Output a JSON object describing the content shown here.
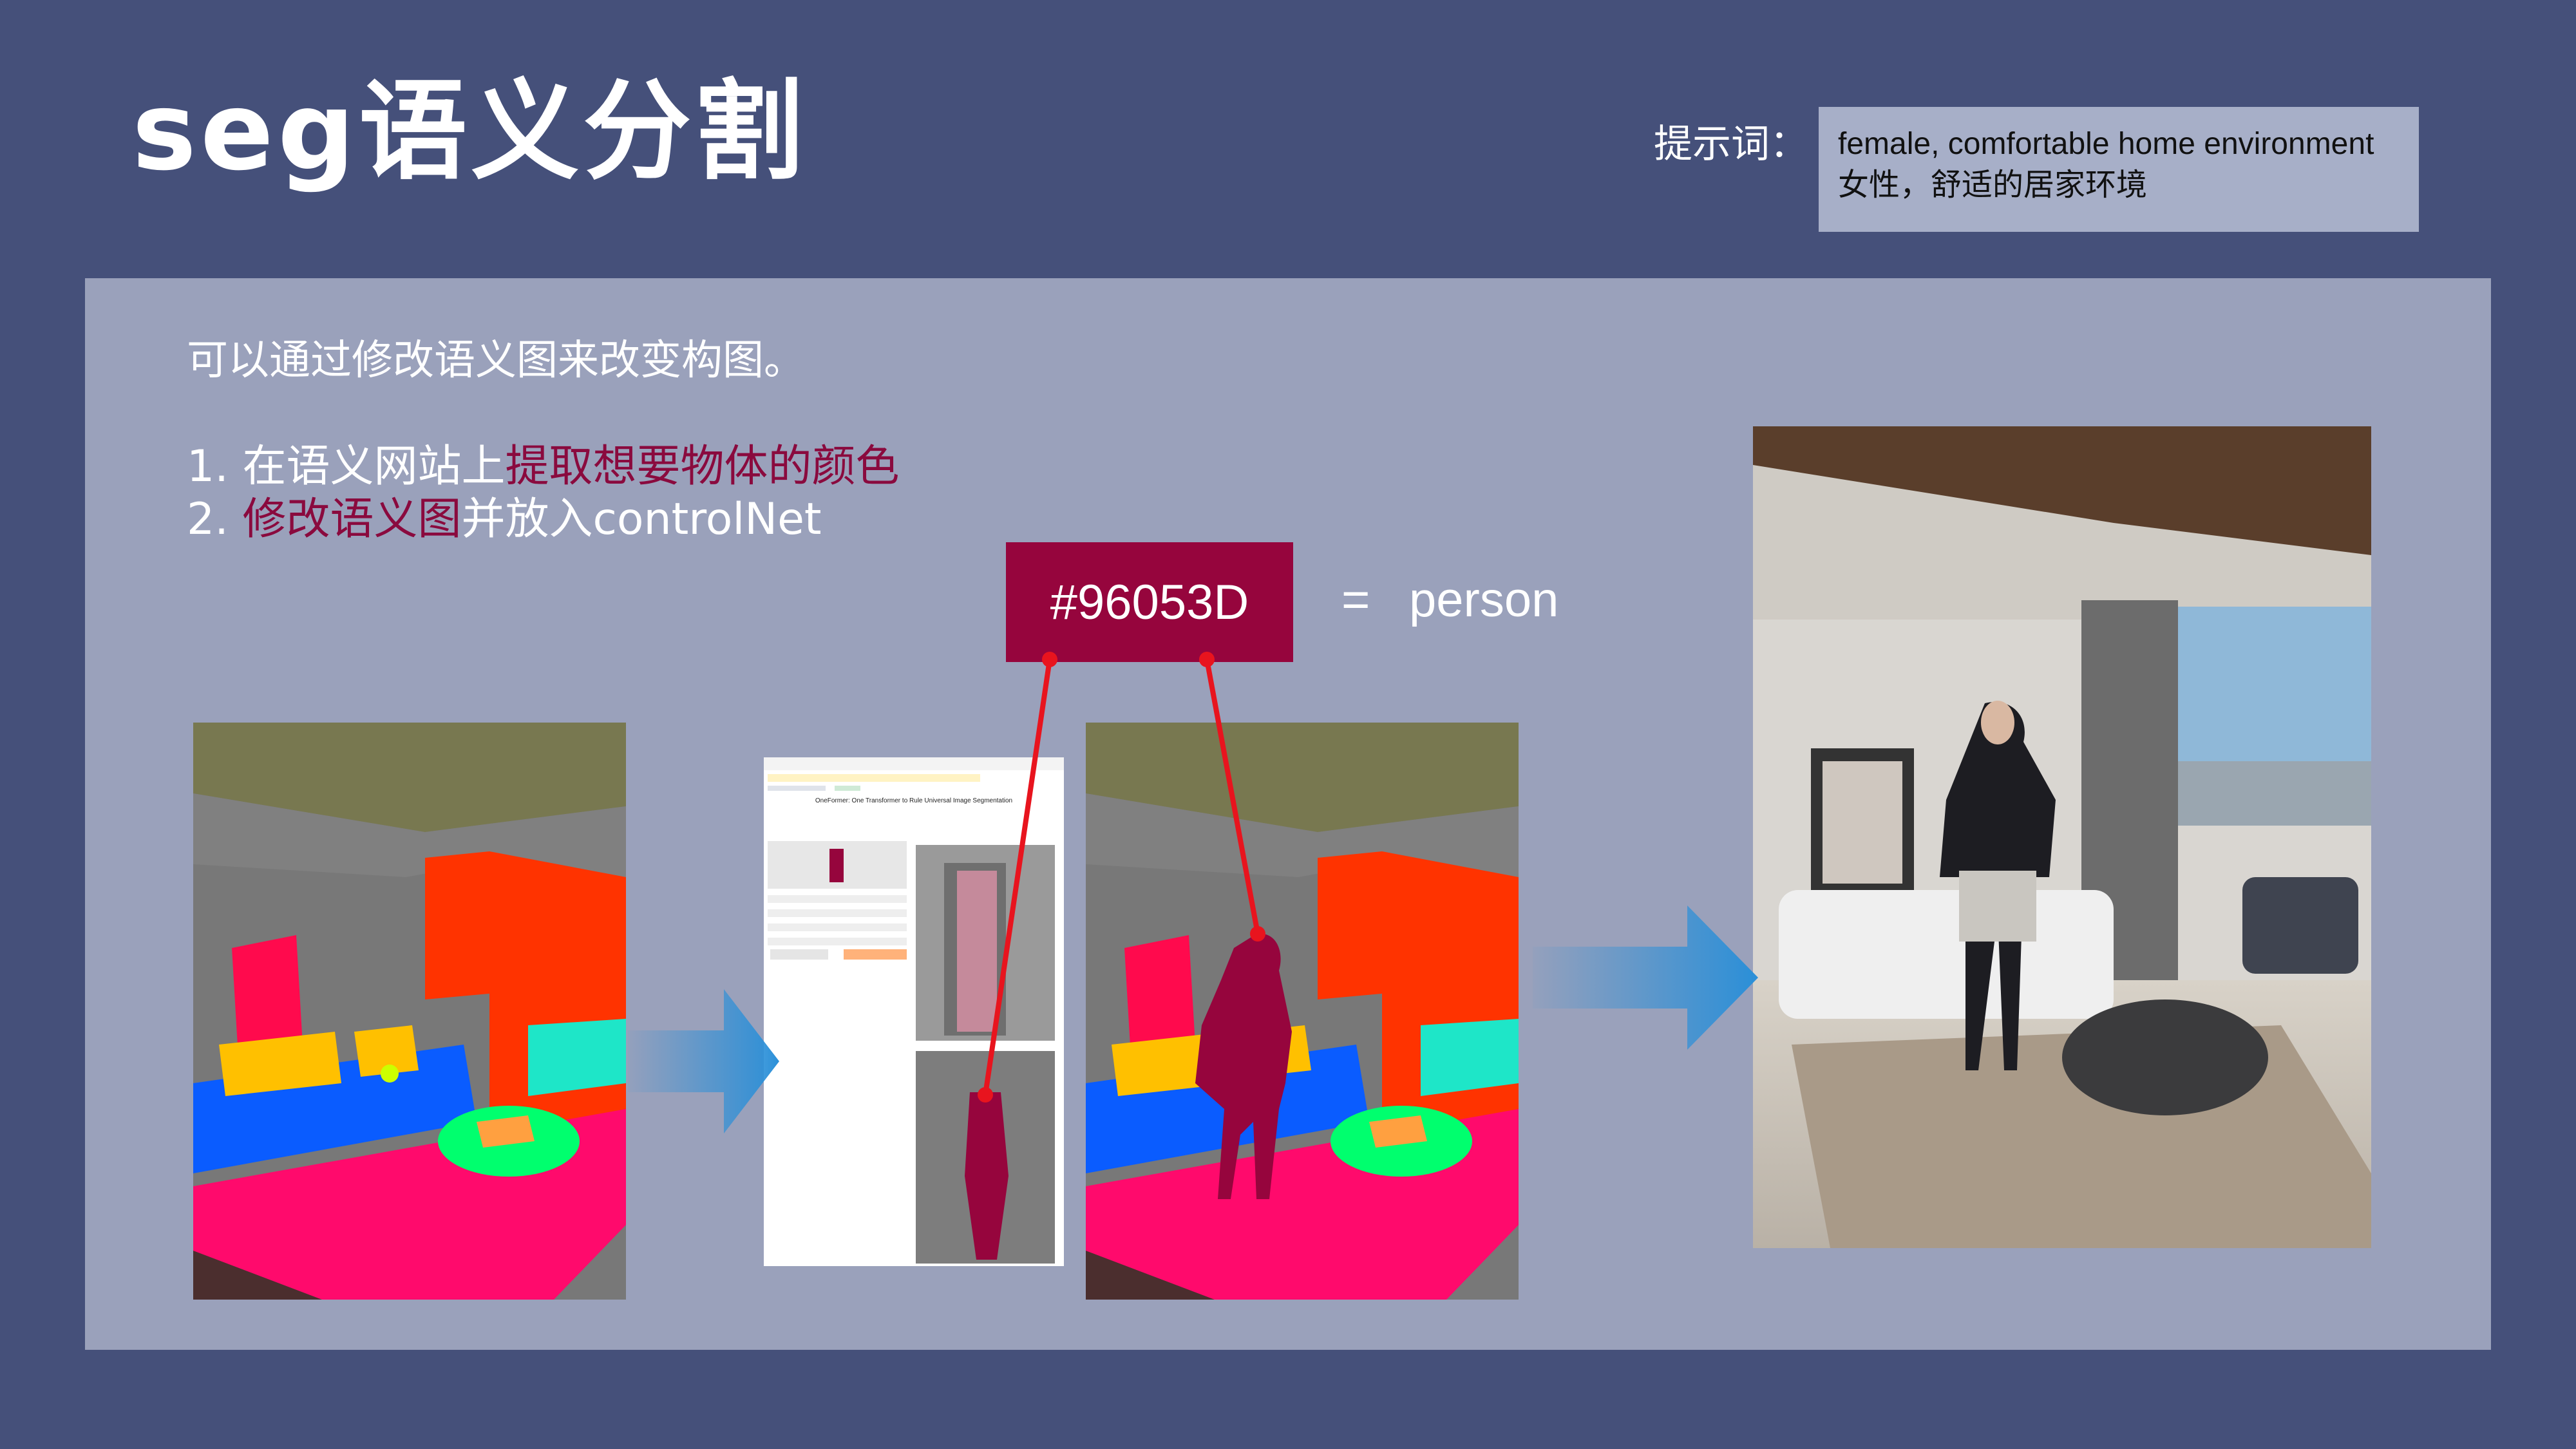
{
  "slide": {
    "title": "seg语义分割",
    "prompt_label": "提示词：",
    "prompt_en": "female, comfortable home environment",
    "prompt_zh": "女性，舒适的居家环境"
  },
  "content": {
    "intro": "可以通过修改语义图来改变构图。",
    "step1_prefix": "1. 在语义网站上",
    "step1_highlight": "提取想要物体的颜色",
    "step2_prefix": "2. ",
    "step2_highlight": "修改语义图",
    "step2_suffix": "并放入controlNet",
    "color_hex": "#96053D",
    "equals": "=",
    "class_name": "person",
    "webpage_title": "OneFormer: One Transformer to Rule Universal Image Segmentation"
  },
  "colors": {
    "background": "#45507a",
    "panel": "#9aa1bb",
    "highlight": "#8a0a3e",
    "person_color": "#96053D",
    "line_red": "#e8141e",
    "arrow_blue": "#2a8fd8"
  }
}
